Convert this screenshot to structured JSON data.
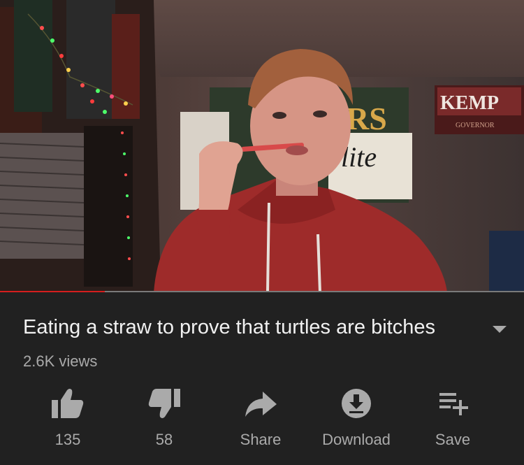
{
  "video": {
    "banner_text": "KEMP",
    "banner_subtext": "GOVERNOR",
    "poster_left_text": "RS",
    "poster_lite_text": "lite",
    "progress_percent": 20
  },
  "title": "Eating a straw to prove that turtles are bitches",
  "views": "2.6K views",
  "actions": {
    "like_count": "135",
    "dislike_count": "58",
    "share_label": "Share",
    "download_label": "Download",
    "save_label": "Save"
  },
  "colors": {
    "background": "#212121",
    "progress_played": "#d51e1e",
    "text_primary": "#f1f1f1",
    "text_secondary": "#aaaaaa"
  },
  "icons": [
    "thumbs-up-icon",
    "thumbs-down-icon",
    "share-icon",
    "download-icon",
    "save-playlist-icon",
    "expand-chevron-icon"
  ]
}
